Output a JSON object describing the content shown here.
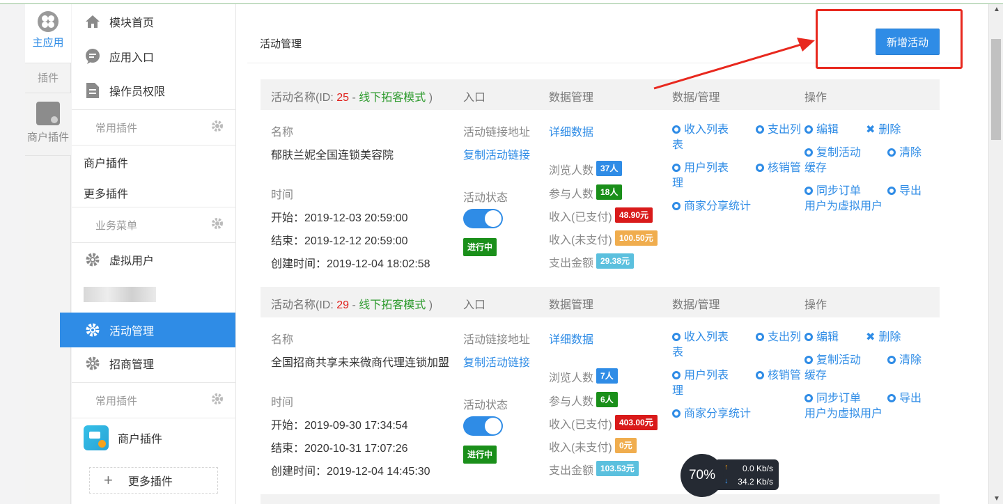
{
  "rail": {
    "main_label": "主应用",
    "plugins_label": "插件",
    "merchant_label": "商户插件"
  },
  "menu": {
    "module_home": "模块首页",
    "app_entry": "应用入口",
    "operator_perm": "操作员权限",
    "common_plugins": "常用插件",
    "merchant_plugin": "商户插件",
    "more_plugins": "更多插件",
    "business_menu": "业务菜单",
    "virtual_user": "虚拟用户",
    "activity_mgmt": "活动管理",
    "recruit_mgmt": "招商管理",
    "common_plugins2": "常用插件",
    "merchant_plugin2": "商户插件",
    "more_plugins2": "更多插件"
  },
  "main": {
    "title": "活动管理",
    "add_button": "新增活动"
  },
  "headers": {
    "name_prefix": "活动名称(ID: ",
    "sep": " - ",
    "suffix": " )",
    "entry": "入口",
    "data_mgmt": "数据管理",
    "data_mgmt2": "数据/管理",
    "ops": "操作"
  },
  "labels": {
    "name": "名称",
    "time": "时间",
    "link_addr": "活动链接地址",
    "copy_link": "复制活动链接",
    "status": "活动状态",
    "detail": "详细数据",
    "views": "浏览人数",
    "participants": "参与人数",
    "income_paid": "收入(已支付)",
    "income_unpaid": "收入(未支付)",
    "expense": "支出金额",
    "income_list_1": "收入列表",
    "income_list_2": "表",
    "expense_list": "支出列",
    "user_list_1": "用户列表",
    "user_list_2": "理",
    "verify_mgmt": "核销管",
    "merchant_share": "商家分享统计",
    "edit": "编辑",
    "delete": "删除",
    "copy_activity": "复制活动",
    "clear": "清除",
    "cache": "缓存",
    "sync_order": "同步订单",
    "export": "导出",
    "sync_virtual": "用户为虚拟用户"
  },
  "activities": [
    {
      "id": "25",
      "mode": "线下拓客模式",
      "name": "郁肤兰妮全国连锁美容院",
      "start": "开始：2019-12-03 20:59:00",
      "end": "结束：2019-12-12 20:59:00",
      "created": "创建时间：2019-12-04 18:02:58",
      "status": "进行中",
      "views": "37人",
      "participants": "18人",
      "income_paid": "48.90元",
      "income_unpaid": "100.50元",
      "expense": "29.38元"
    },
    {
      "id": "29",
      "mode": "线下拓客模式",
      "name": "全国招商共享未来微商代理连锁加盟",
      "start": "开始：2019-09-30 17:34:54",
      "end": "结束：2020-10-31 17:07:26",
      "created": "创建时间：2019-12-04 14:45:30",
      "status": "进行中",
      "views": "7人",
      "participants": "6人",
      "income_paid": "403.00元",
      "income_unpaid": "0元",
      "expense": "103.53元"
    }
  ],
  "network": {
    "percent": "70%",
    "up": "0.0 Kb/s",
    "down": "34.2 Kb/s"
  },
  "icons": [
    "home-icon",
    "chat-icon",
    "document-icon",
    "gear-icon",
    "apps-icon",
    "merchant-icon",
    "plus-icon",
    "cog-icon",
    "close-icon"
  ],
  "colors": {
    "accent": "#2f8ce6",
    "danger": "#e0201c",
    "success": "#2c9a2c"
  }
}
